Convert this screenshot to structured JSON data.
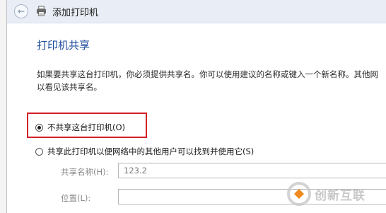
{
  "window": {
    "title": "添加打印机",
    "back_glyph": "←"
  },
  "page": {
    "heading": "打印机共享",
    "description_line1": "如果要共享这台打印机，你必须提供共享名。你可以使用建议的名称或键入一个新名称。其他网",
    "description_line2": "以看见该共享名。"
  },
  "options": {
    "no_share_label": "不共享这台打印机(O)",
    "share_label": "共享此打印机以便网络中的其他用户可以找到并使用它(S)",
    "selected": "no_share"
  },
  "fields": {
    "share_name_label": "共享名称(H):",
    "share_name_value": "123.2",
    "location_label": "位置(L):",
    "location_value": ""
  },
  "watermark": {
    "text": "创新互联"
  },
  "colors": {
    "heading": "#1c4b9a",
    "highlight": "#d42027"
  }
}
